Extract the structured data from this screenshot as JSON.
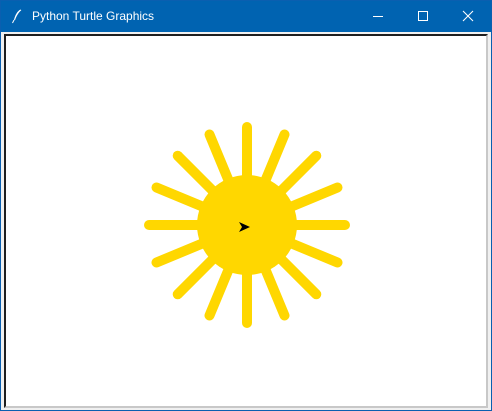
{
  "window": {
    "title": "Python Turtle Graphics",
    "app_icon": "feather-icon",
    "controls": {
      "minimize": "minimize-icon",
      "maximize": "maximize-icon",
      "close": "close-icon"
    }
  },
  "canvas": {
    "background": "#ffffff",
    "drawing": {
      "subject": "sun",
      "fill_color": "#ffd700",
      "ray_count": 16,
      "turtle_cursor_color": "#000000",
      "turtle_heading": "east"
    }
  },
  "colors": {
    "titlebar": "#0063b1",
    "title_text": "#ffffff"
  }
}
